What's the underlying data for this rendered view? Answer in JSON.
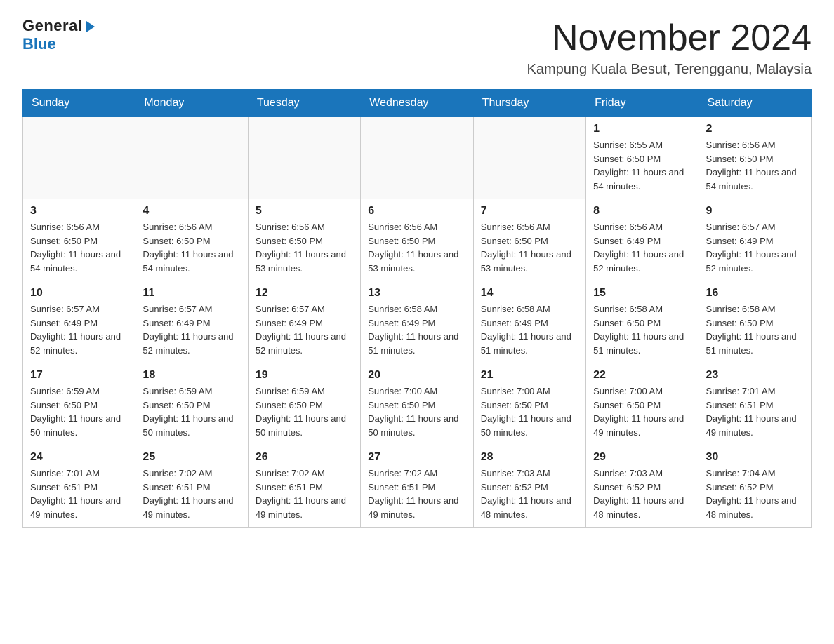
{
  "logo": {
    "general": "General",
    "blue": "Blue"
  },
  "header": {
    "month_year": "November 2024",
    "location": "Kampung Kuala Besut, Terengganu, Malaysia"
  },
  "weekdays": [
    "Sunday",
    "Monday",
    "Tuesday",
    "Wednesday",
    "Thursday",
    "Friday",
    "Saturday"
  ],
  "weeks": [
    [
      {
        "day": "",
        "info": ""
      },
      {
        "day": "",
        "info": ""
      },
      {
        "day": "",
        "info": ""
      },
      {
        "day": "",
        "info": ""
      },
      {
        "day": "",
        "info": ""
      },
      {
        "day": "1",
        "info": "Sunrise: 6:55 AM\nSunset: 6:50 PM\nDaylight: 11 hours and 54 minutes."
      },
      {
        "day": "2",
        "info": "Sunrise: 6:56 AM\nSunset: 6:50 PM\nDaylight: 11 hours and 54 minutes."
      }
    ],
    [
      {
        "day": "3",
        "info": "Sunrise: 6:56 AM\nSunset: 6:50 PM\nDaylight: 11 hours and 54 minutes."
      },
      {
        "day": "4",
        "info": "Sunrise: 6:56 AM\nSunset: 6:50 PM\nDaylight: 11 hours and 54 minutes."
      },
      {
        "day": "5",
        "info": "Sunrise: 6:56 AM\nSunset: 6:50 PM\nDaylight: 11 hours and 53 minutes."
      },
      {
        "day": "6",
        "info": "Sunrise: 6:56 AM\nSunset: 6:50 PM\nDaylight: 11 hours and 53 minutes."
      },
      {
        "day": "7",
        "info": "Sunrise: 6:56 AM\nSunset: 6:50 PM\nDaylight: 11 hours and 53 minutes."
      },
      {
        "day": "8",
        "info": "Sunrise: 6:56 AM\nSunset: 6:49 PM\nDaylight: 11 hours and 52 minutes."
      },
      {
        "day": "9",
        "info": "Sunrise: 6:57 AM\nSunset: 6:49 PM\nDaylight: 11 hours and 52 minutes."
      }
    ],
    [
      {
        "day": "10",
        "info": "Sunrise: 6:57 AM\nSunset: 6:49 PM\nDaylight: 11 hours and 52 minutes."
      },
      {
        "day": "11",
        "info": "Sunrise: 6:57 AM\nSunset: 6:49 PM\nDaylight: 11 hours and 52 minutes."
      },
      {
        "day": "12",
        "info": "Sunrise: 6:57 AM\nSunset: 6:49 PM\nDaylight: 11 hours and 52 minutes."
      },
      {
        "day": "13",
        "info": "Sunrise: 6:58 AM\nSunset: 6:49 PM\nDaylight: 11 hours and 51 minutes."
      },
      {
        "day": "14",
        "info": "Sunrise: 6:58 AM\nSunset: 6:49 PM\nDaylight: 11 hours and 51 minutes."
      },
      {
        "day": "15",
        "info": "Sunrise: 6:58 AM\nSunset: 6:50 PM\nDaylight: 11 hours and 51 minutes."
      },
      {
        "day": "16",
        "info": "Sunrise: 6:58 AM\nSunset: 6:50 PM\nDaylight: 11 hours and 51 minutes."
      }
    ],
    [
      {
        "day": "17",
        "info": "Sunrise: 6:59 AM\nSunset: 6:50 PM\nDaylight: 11 hours and 50 minutes."
      },
      {
        "day": "18",
        "info": "Sunrise: 6:59 AM\nSunset: 6:50 PM\nDaylight: 11 hours and 50 minutes."
      },
      {
        "day": "19",
        "info": "Sunrise: 6:59 AM\nSunset: 6:50 PM\nDaylight: 11 hours and 50 minutes."
      },
      {
        "day": "20",
        "info": "Sunrise: 7:00 AM\nSunset: 6:50 PM\nDaylight: 11 hours and 50 minutes."
      },
      {
        "day": "21",
        "info": "Sunrise: 7:00 AM\nSunset: 6:50 PM\nDaylight: 11 hours and 50 minutes."
      },
      {
        "day": "22",
        "info": "Sunrise: 7:00 AM\nSunset: 6:50 PM\nDaylight: 11 hours and 49 minutes."
      },
      {
        "day": "23",
        "info": "Sunrise: 7:01 AM\nSunset: 6:51 PM\nDaylight: 11 hours and 49 minutes."
      }
    ],
    [
      {
        "day": "24",
        "info": "Sunrise: 7:01 AM\nSunset: 6:51 PM\nDaylight: 11 hours and 49 minutes."
      },
      {
        "day": "25",
        "info": "Sunrise: 7:02 AM\nSunset: 6:51 PM\nDaylight: 11 hours and 49 minutes."
      },
      {
        "day": "26",
        "info": "Sunrise: 7:02 AM\nSunset: 6:51 PM\nDaylight: 11 hours and 49 minutes."
      },
      {
        "day": "27",
        "info": "Sunrise: 7:02 AM\nSunset: 6:51 PM\nDaylight: 11 hours and 49 minutes."
      },
      {
        "day": "28",
        "info": "Sunrise: 7:03 AM\nSunset: 6:52 PM\nDaylight: 11 hours and 48 minutes."
      },
      {
        "day": "29",
        "info": "Sunrise: 7:03 AM\nSunset: 6:52 PM\nDaylight: 11 hours and 48 minutes."
      },
      {
        "day": "30",
        "info": "Sunrise: 7:04 AM\nSunset: 6:52 PM\nDaylight: 11 hours and 48 minutes."
      }
    ]
  ]
}
